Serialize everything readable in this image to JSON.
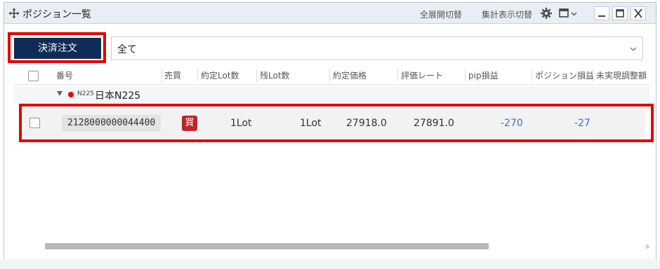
{
  "window": {
    "title": "ポジション一覧",
    "expand_toggle_label": "全展開切替",
    "summary_toggle_label": "集計表示切替"
  },
  "toolbar": {
    "settle_button_label": "決済注文",
    "filter_value": "全て"
  },
  "table": {
    "headers": {
      "number": "番号",
      "side": "売買",
      "contract_lots": "約定Lot数",
      "remaining_lots": "残Lot数",
      "contract_price": "約定価格",
      "eval_rate": "評価レート",
      "pip_pnl": "pip損益",
      "position_pnl": "ポジション損益",
      "unrealized_adj": "未実現調整額"
    },
    "group": {
      "code": "N225",
      "name": "日本N225"
    },
    "rows": [
      {
        "id": "2128000000044400",
        "side": "買",
        "contract_lots": "1Lot",
        "remaining_lots": "1Lot",
        "contract_price": "27918.0",
        "eval_rate": "27891.0",
        "pip_pnl": "-270",
        "position_pnl": "-27"
      }
    ]
  },
  "colors": {
    "accent_navy": "#0e2c55",
    "highlight_red": "#e60000",
    "buy_red": "#c0252c",
    "negative_blue": "#3b6fd8"
  },
  "icons": {
    "move": "move-icon",
    "settings": "gear-icon",
    "layout": "layout-menu-icon",
    "minimize": "minimize-icon",
    "maximize": "maximize-icon",
    "close": "close-icon"
  }
}
